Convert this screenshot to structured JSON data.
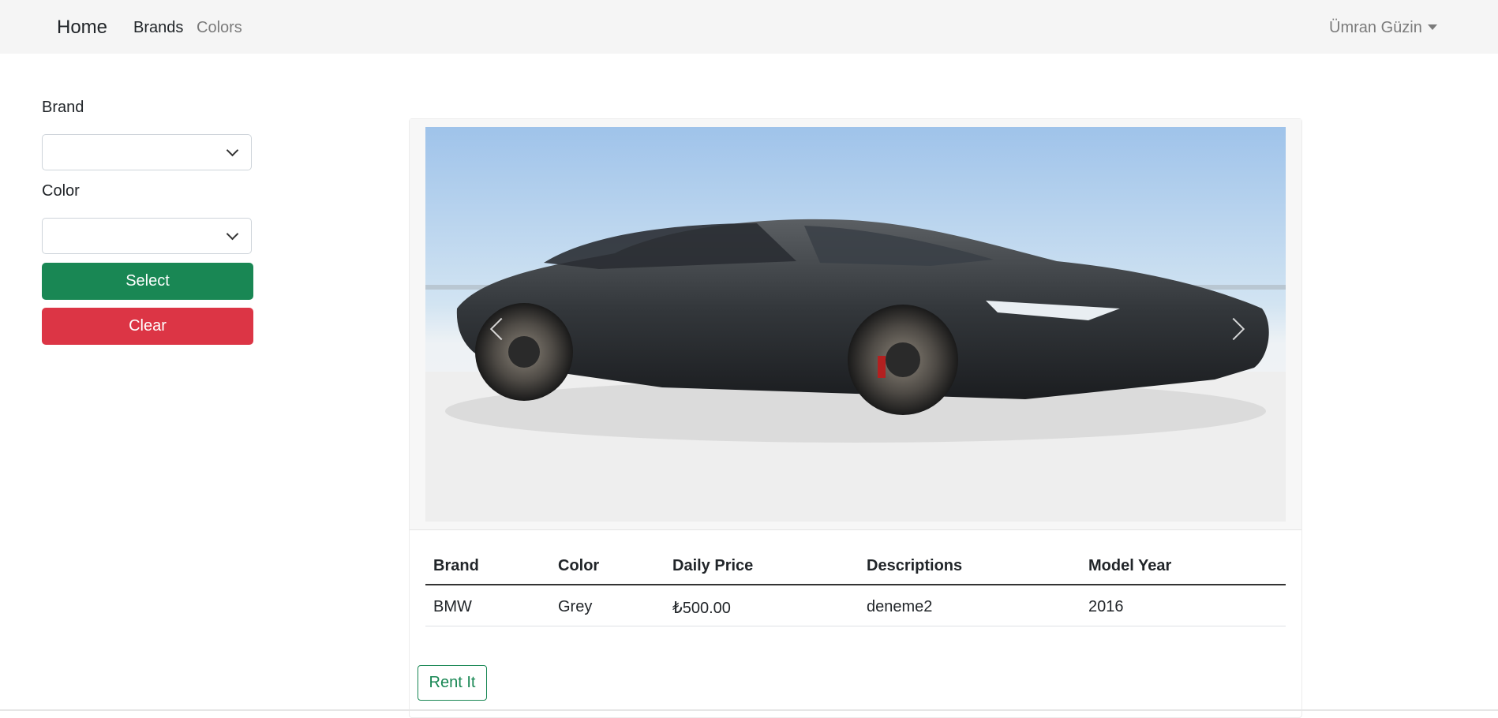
{
  "navbar": {
    "brand": "Home",
    "links": [
      "Brands",
      "Colors"
    ],
    "user": "Ümran Güzin"
  },
  "filters": {
    "brand_label": "Brand",
    "brand_value": "",
    "color_label": "Color",
    "color_value": "",
    "select_button": "Select",
    "clear_button": "Clear"
  },
  "car": {
    "table": {
      "headers": [
        "Brand",
        "Color",
        "Daily Price",
        "Descriptions",
        "Model Year"
      ],
      "row": [
        "BMW",
        "Grey",
        "₺500.00",
        "deneme2",
        "2016"
      ]
    },
    "rent_button": "Rent It"
  },
  "colors": {
    "success": "#198754",
    "danger": "#dc3545",
    "navbar_bg": "#f5f5f5"
  }
}
